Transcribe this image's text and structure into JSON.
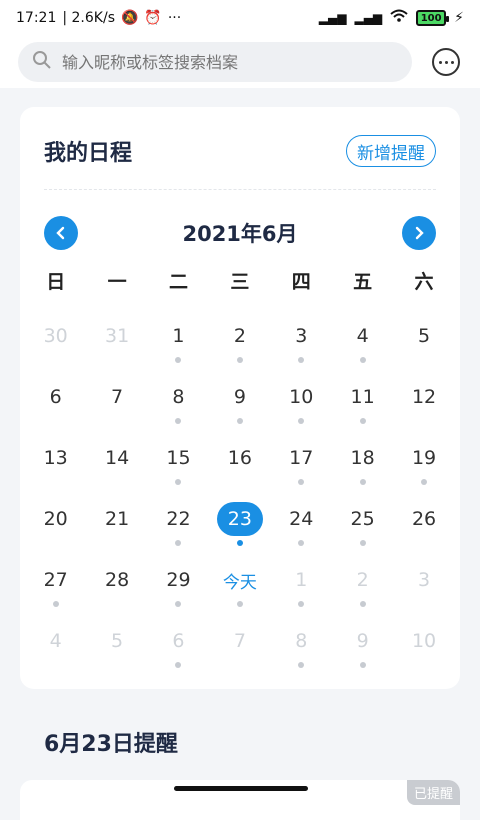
{
  "status": {
    "time": "17:21",
    "speed": "| 2.6K/s",
    "more": "···",
    "battery": "100"
  },
  "search": {
    "placeholder": "输入昵称或标签搜索档案"
  },
  "card": {
    "title": "我的日程",
    "add_label": "新增提醒"
  },
  "calendar": {
    "month_title": "2021年6月",
    "weekdays": [
      "日",
      "一",
      "二",
      "三",
      "四",
      "五",
      "六"
    ],
    "weeks": [
      [
        {
          "label": "30",
          "faded": true,
          "dot": false
        },
        {
          "label": "31",
          "faded": true,
          "dot": false
        },
        {
          "label": "1",
          "faded": false,
          "dot": true
        },
        {
          "label": "2",
          "faded": false,
          "dot": true
        },
        {
          "label": "3",
          "faded": false,
          "dot": true
        },
        {
          "label": "4",
          "faded": false,
          "dot": true
        },
        {
          "label": "5",
          "faded": false,
          "dot": false
        }
      ],
      [
        {
          "label": "6",
          "faded": false,
          "dot": false
        },
        {
          "label": "7",
          "faded": false,
          "dot": false
        },
        {
          "label": "8",
          "faded": false,
          "dot": true
        },
        {
          "label": "9",
          "faded": false,
          "dot": true
        },
        {
          "label": "10",
          "faded": false,
          "dot": true
        },
        {
          "label": "11",
          "faded": false,
          "dot": true
        },
        {
          "label": "12",
          "faded": false,
          "dot": false
        }
      ],
      [
        {
          "label": "13",
          "faded": false,
          "dot": false
        },
        {
          "label": "14",
          "faded": false,
          "dot": false
        },
        {
          "label": "15",
          "faded": false,
          "dot": true
        },
        {
          "label": "16",
          "faded": false,
          "dot": false
        },
        {
          "label": "17",
          "faded": false,
          "dot": true
        },
        {
          "label": "18",
          "faded": false,
          "dot": true
        },
        {
          "label": "19",
          "faded": false,
          "dot": true
        }
      ],
      [
        {
          "label": "20",
          "faded": false,
          "dot": false
        },
        {
          "label": "21",
          "faded": false,
          "dot": false
        },
        {
          "label": "22",
          "faded": false,
          "dot": true
        },
        {
          "label": "23",
          "faded": false,
          "dot": true,
          "selected": true
        },
        {
          "label": "24",
          "faded": false,
          "dot": true
        },
        {
          "label": "25",
          "faded": false,
          "dot": true
        },
        {
          "label": "26",
          "faded": false,
          "dot": false
        }
      ],
      [
        {
          "label": "27",
          "faded": false,
          "dot": true
        },
        {
          "label": "28",
          "faded": false,
          "dot": false
        },
        {
          "label": "29",
          "faded": false,
          "dot": true
        },
        {
          "label": "今天",
          "faded": false,
          "dot": true,
          "todaylabel": true
        },
        {
          "label": "1",
          "faded": true,
          "dot": true
        },
        {
          "label": "2",
          "faded": true,
          "dot": true
        },
        {
          "label": "3",
          "faded": true,
          "dot": false
        }
      ],
      [
        {
          "label": "4",
          "faded": true,
          "dot": false
        },
        {
          "label": "5",
          "faded": true,
          "dot": false
        },
        {
          "label": "6",
          "faded": true,
          "dot": true
        },
        {
          "label": "7",
          "faded": true,
          "dot": false
        },
        {
          "label": "8",
          "faded": true,
          "dot": true
        },
        {
          "label": "9",
          "faded": true,
          "dot": true
        },
        {
          "label": "10",
          "faded": true,
          "dot": false
        }
      ]
    ]
  },
  "reminders": {
    "section_title": "6月23日提醒",
    "badge": "已提醒"
  },
  "colors": {
    "accent": "#1a8fe3",
    "dot": "#c7cbd1"
  }
}
